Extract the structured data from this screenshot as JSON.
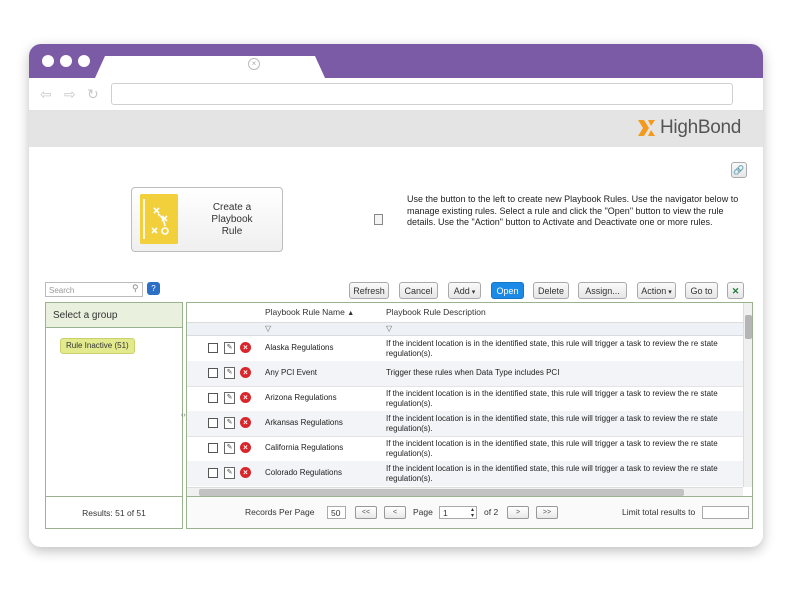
{
  "brand": {
    "name": "HighBond"
  },
  "toolbar": {
    "refresh": "Refresh",
    "cancel": "Cancel",
    "add": "Add",
    "open": "Open",
    "delete": "Delete",
    "assign": "Assign...",
    "action": "Action",
    "goto": "Go to"
  },
  "create": {
    "line1": "Create a",
    "line2": "Playbook",
    "line3": "Rule"
  },
  "description": "Use the button to the left to create new Playbook Rules.  Use the navigator below to manage existing rules.  Select a rule and click the \"Open\" button to view the rule details.  Use the \"Action\" button to Activate and Deactivate one or more rules.",
  "search": {
    "placeholder": "Search"
  },
  "groups": {
    "header": "Select a group",
    "items": [
      {
        "label": "Rule Inactive (51)"
      }
    ],
    "results": "Results: 51 of 51"
  },
  "grid": {
    "columns": {
      "name": "Playbook Rule Name",
      "description": "Playbook Rule Description"
    },
    "rows": [
      {
        "name": "Alaska Regulations",
        "desc": "If the incident location is in the identified state, this rule will trigger a task to review the re state regulation(s)."
      },
      {
        "name": "Any PCI Event",
        "desc": "Trigger these rules when Data Type includes PCI"
      },
      {
        "name": "Arizona Regulations",
        "desc": "If the incident location is in the identified state, this rule will trigger a task to review the re state regulation(s)."
      },
      {
        "name": "Arkansas Regulations",
        "desc": "If the incident location is in the identified state, this rule will trigger a task to review the re state regulation(s)."
      },
      {
        "name": "California Regulations",
        "desc": "If the incident location is in the identified state, this rule will trigger a task to review the re state regulation(s)."
      },
      {
        "name": "Colorado Regulations",
        "desc": "If the incident location is in the identified state, this rule will trigger a task to review the re state regulation(s)."
      }
    ]
  },
  "pager": {
    "records_label": "Records Per Page",
    "records_value": "50",
    "first": "<<",
    "prev": "<",
    "page_label": "Page",
    "page_value": "1",
    "of_label": "of 2",
    "next": ">",
    "last": ">>",
    "limit_label": "Limit total results to"
  },
  "colors": {
    "titlebar": "#7b5aa6",
    "accent": "#1a8ae6",
    "logo_orange": "#f39a1e",
    "danger": "#d8262c"
  }
}
